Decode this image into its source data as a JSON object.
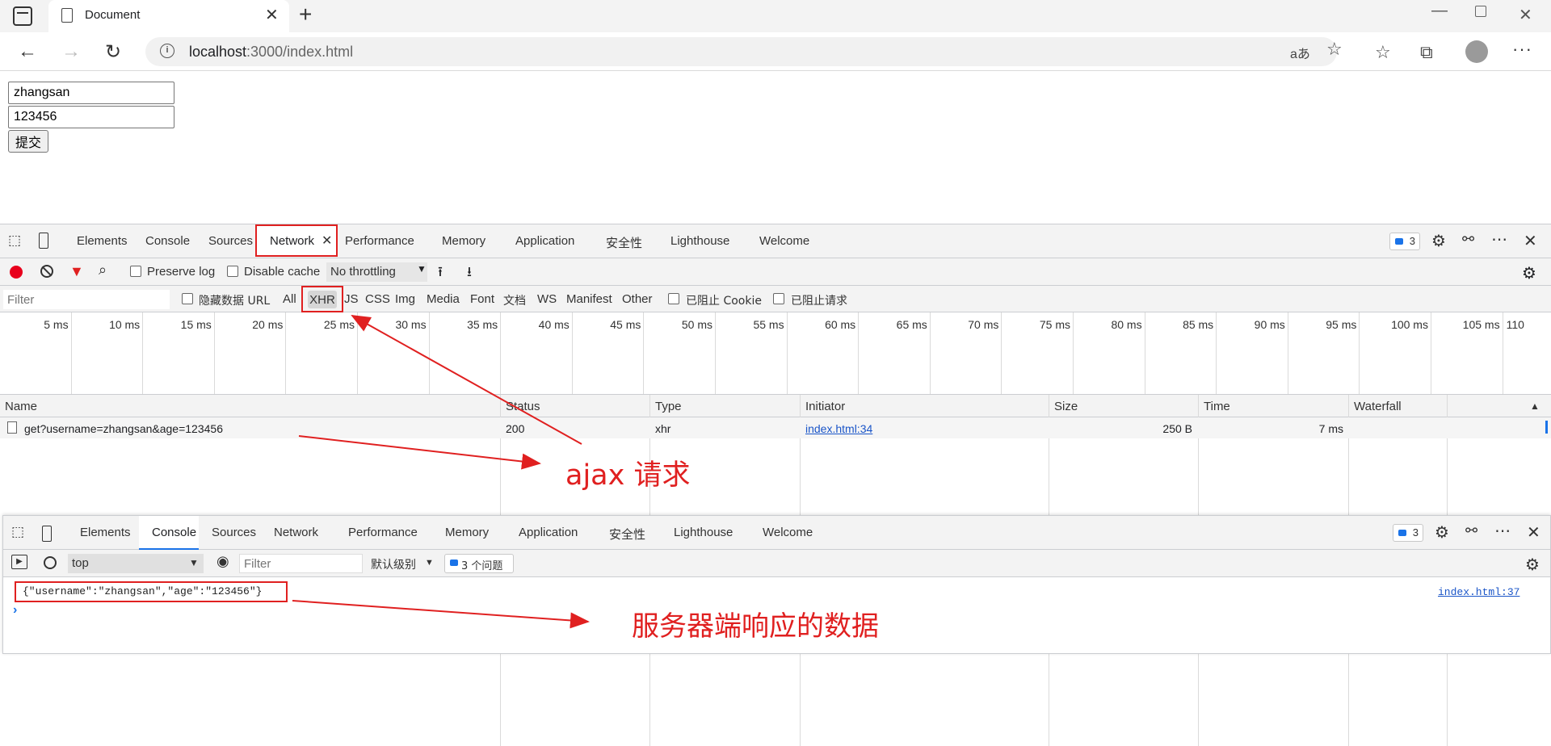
{
  "browser": {
    "tab_title": "Document",
    "tab_close": "✕",
    "new_tab": "+",
    "url_host": "localhost",
    "url_path": ":3000/index.html",
    "read_aloud": "aあ"
  },
  "form": {
    "username_value": "zhangsan",
    "age_value": "123456",
    "submit_label": "提交"
  },
  "devtools": {
    "tabs": [
      "Elements",
      "Console",
      "Sources",
      "Network",
      "Performance",
      "Memory",
      "Application",
      "安全性",
      "Lighthouse",
      "Welcome"
    ],
    "issues_count": "3",
    "network_toolbar": {
      "preserve_log": "Preserve log",
      "disable_cache": "Disable cache",
      "throttling": "No throttling"
    },
    "filter_bar": {
      "placeholder": "Filter",
      "hide_data_urls": "隐藏数据 URL",
      "types": [
        "All",
        "XHR",
        "JS",
        "CSS",
        "Img",
        "Media",
        "Font",
        "文档",
        "WS",
        "Manifest",
        "Other"
      ],
      "blocked_cookies": "已阻止 Cookie",
      "blocked_requests": "已阻止请求"
    },
    "timeline_ticks": [
      "5 ms",
      "10 ms",
      "15 ms",
      "20 ms",
      "25 ms",
      "30 ms",
      "35 ms",
      "40 ms",
      "45 ms",
      "50 ms",
      "55 ms",
      "60 ms",
      "65 ms",
      "70 ms",
      "75 ms",
      "80 ms",
      "85 ms",
      "90 ms",
      "95 ms",
      "100 ms",
      "105 ms",
      "110"
    ],
    "table": {
      "columns": [
        "Name",
        "Status",
        "Type",
        "Initiator",
        "Size",
        "Time",
        "Waterfall"
      ],
      "rows": [
        {
          "name": "get?username=zhangsan&age=123456",
          "status": "200",
          "type": "xhr",
          "initiator": "index.html:34",
          "size": "250 B",
          "time": "7 ms"
        }
      ]
    }
  },
  "console_drawer": {
    "tabs": [
      "Elements",
      "Console",
      "Sources",
      "Network",
      "Performance",
      "Memory",
      "Application",
      "安全性",
      "Lighthouse",
      "Welcome"
    ],
    "issues_count": "3",
    "context": "top",
    "filter_placeholder": "Filter",
    "log_level": "默认级别",
    "issues_button": "3 个问题",
    "log_message": "{\"username\":\"zhangsan\",\"age\":\"123456\"}",
    "log_source": "index.html:37",
    "prompt": "›"
  },
  "annotations": {
    "ajax_request": "ajax 请求",
    "server_response": "服务器端响应的数据"
  }
}
